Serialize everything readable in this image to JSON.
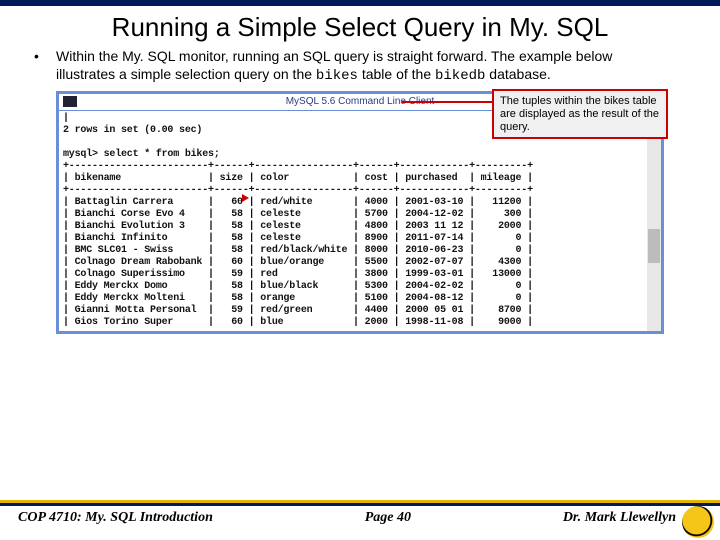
{
  "title": "Running a Simple Select Query in My. SQL",
  "bullet_text_1": "Within the My. SQL monitor, running an SQL query is straight forward.  The example below illustrates a simple selection query on the ",
  "bullet_mono_1": "bikes",
  "bullet_text_2": " table of the ",
  "bullet_mono_2": "bikedb",
  "bullet_text_3": " database.",
  "window_title": "MySQL 5.6 Command Line Client",
  "callout_text": "The tuples within the bikes table are displayed as the result of the query.",
  "terminal_lines": "|\n2 rows in set (0.00 sec)\n\nmysql> select * from bikes;\n+------------------------+------+-----------------+------+------------+---------+\n| bikename               | size | color           | cost | purchased  | mileage |\n+------------------------+------+-----------------+------+------------+---------+\n| Battaglin Carrera      |   60 | red/white       | 4000 | 2001-03-10 |   11200 |\n| Bianchi Corse Evo 4    |   58 | celeste         | 5700 | 2004-12-02 |     300 |\n| Bianchi Evolution 3    |   58 | celeste         | 4800 | 2003 11 12 |    2000 |\n| Bianchi Infinito       |   58 | celeste         | 8900 | 2011-07-14 |       0 |\n| BMC SLC01 - Swiss      |   58 | red/black/white | 8000 | 2010-06-23 |       0 |\n| Colnago Dream Rabobank |   60 | blue/orange     | 5500 | 2002-07-07 |    4300 |\n| Colnago Superissimo    |   59 | red             | 3800 | 1999-03-01 |   13000 |\n| Eddy Merckx Domo       |   58 | blue/black      | 5300 | 2004-02-02 |       0 |\n| Eddy Merckx Molteni    |   58 | orange          | 5100 | 2004-08-12 |       0 |\n| Gianni Motta Personal  |   59 | red/green       | 4400 | 2000 05 01 |    8700 |\n| Gios Torino Super      |   60 | blue            | 2000 | 1998-11-08 |    9000 |",
  "footer": {
    "course": "COP 4710: My. SQL Introduction",
    "page": "Page 40",
    "author": "Dr. Mark Llewellyn"
  }
}
